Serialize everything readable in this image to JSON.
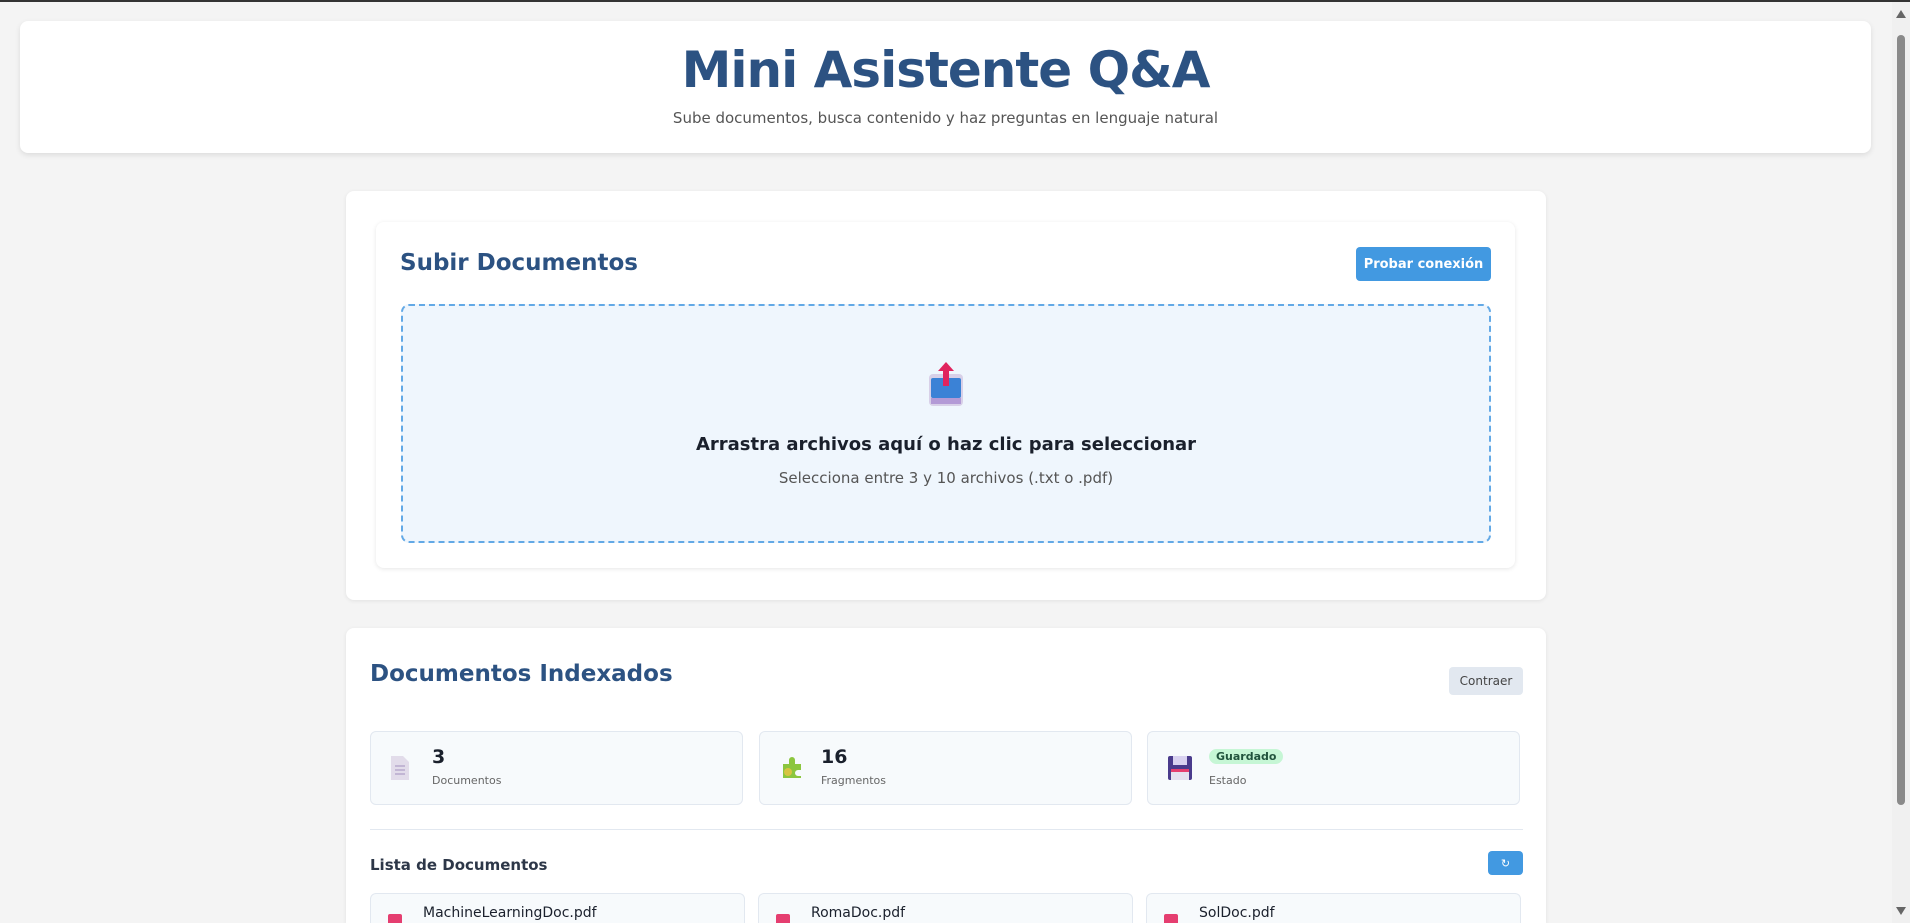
{
  "header": {
    "title": "Mini Asistente Q&A",
    "subtitle": "Sube documentos, busca contenido y haz preguntas en lenguaje natural"
  },
  "upload": {
    "title": "Subir Documentos",
    "test_button": "Probar conexión",
    "drop_title": "Arrastra archivos aquí o haz clic para seleccionar",
    "drop_sub": "Selecciona entre 3 y 10 archivos (.txt o .pdf)",
    "icon": "inbox-upload-icon"
  },
  "indexed": {
    "title": "Documentos Indexados",
    "collapse_button": "Contraer",
    "stats": [
      {
        "value": "3",
        "label": "Documentos",
        "icon": "document-icon"
      },
      {
        "value": "16",
        "label": "Fragmentos",
        "icon": "puzzle-icon"
      },
      {
        "badge": "Guardado",
        "label": "Estado",
        "icon": "floppy-disk-icon"
      }
    ],
    "list_title": "Lista de Documentos",
    "refresh_icon": "refresh-icon",
    "documents": [
      {
        "name": "MachineLearningDoc.pdf"
      },
      {
        "name": "RomaDoc.pdf"
      },
      {
        "name": "SolDoc.pdf"
      }
    ]
  },
  "colors": {
    "primary": "#4299e1",
    "title": "#2c5282",
    "badge_bg": "#c6f6d5"
  }
}
